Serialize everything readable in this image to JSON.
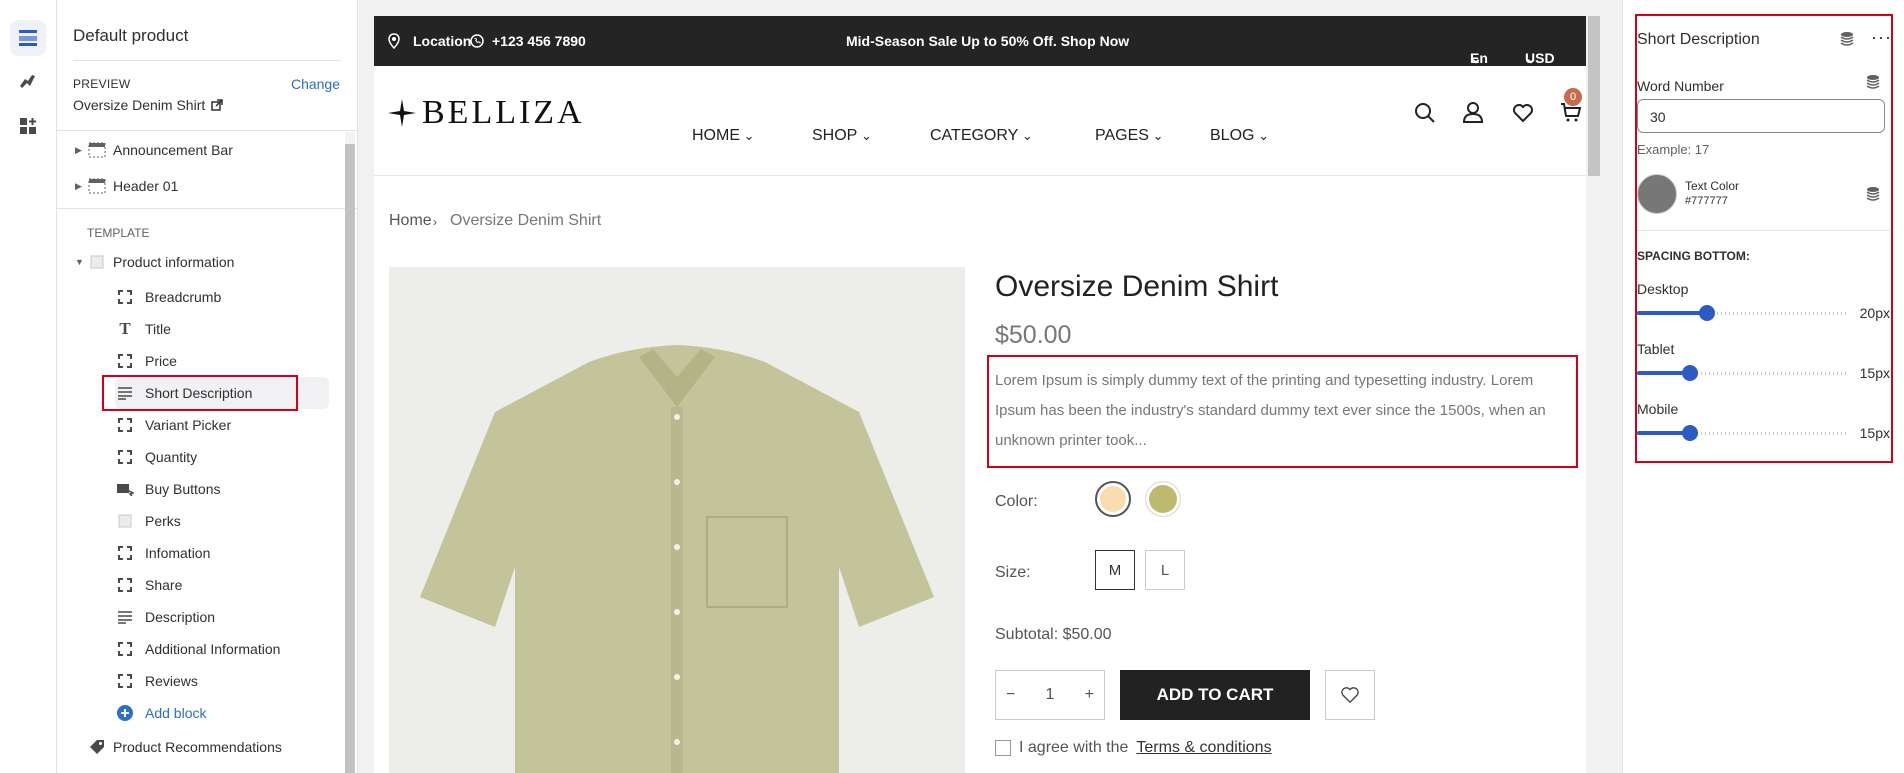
{
  "sidebar": {
    "title": "Default product",
    "preview_label": "PREVIEW",
    "change_label": "Change",
    "preview_value": "Oversize Denim Shirt",
    "sections": [
      {
        "label": "Announcement Bar"
      },
      {
        "label": "Header 01"
      }
    ],
    "template_label": "TEMPLATE",
    "product_info_label": "Product information",
    "blocks": [
      {
        "label": "Breadcrumb",
        "icon": "bracket-icon"
      },
      {
        "label": "Title",
        "icon": "text-icon"
      },
      {
        "label": "Price",
        "icon": "bracket-icon"
      },
      {
        "label": "Short Description",
        "icon": "paragraph-icon"
      },
      {
        "label": "Variant Picker",
        "icon": "bracket-icon"
      },
      {
        "label": "Quantity",
        "icon": "bracket-icon"
      },
      {
        "label": "Buy Buttons",
        "icon": "buy-icon"
      },
      {
        "label": "Perks",
        "icon": "image-icon"
      },
      {
        "label": "Infomation",
        "icon": "bracket-icon"
      },
      {
        "label": "Share",
        "icon": "bracket-icon"
      },
      {
        "label": "Description",
        "icon": "paragraph-icon"
      },
      {
        "label": "Additional Information",
        "icon": "bracket-icon"
      },
      {
        "label": "Reviews",
        "icon": "bracket-icon"
      }
    ],
    "add_block_label": "Add block",
    "recommendations_label": "Product Recommendations"
  },
  "store": {
    "topbar": {
      "location": "Location",
      "phone": "+123 456 7890",
      "promo": "Mid-Season Sale Up to 50% Off. Shop Now",
      "language": "En",
      "currency": "USD"
    },
    "logo": "BELLIZA",
    "nav": [
      "HOME",
      "SHOP",
      "CATEGORY",
      "PAGES",
      "BLOG"
    ],
    "cart_count": "0",
    "breadcrumb": {
      "home": "Home",
      "current": "Oversize Denim Shirt"
    },
    "product": {
      "title": "Oversize Denim Shirt",
      "price": "$50.00",
      "description": "Lorem Ipsum is simply dummy text of the printing and typesetting industry. Lorem Ipsum has been the industry's standard dummy text ever since the 1500s, when an unknown printer took...",
      "color_label": "Color:",
      "color_swatches": [
        "#f7ddb0",
        "#bdb96f"
      ],
      "size_label": "Size:",
      "sizes": [
        "M",
        "L"
      ],
      "subtotal": "Subtotal: $50.00",
      "quantity": "1",
      "add_to_cart": "ADD TO CART",
      "agree_prefix": "I agree with the",
      "agree_link": "Terms & conditions"
    }
  },
  "settings": {
    "title": "Short Description",
    "word_number_label": "Word Number",
    "word_number_value": "30",
    "example": "Example: 17",
    "text_color_label": "Text Color",
    "text_color_value": "#777777",
    "spacing_label": "SPACING BOTTOM:",
    "sliders": [
      {
        "label": "Desktop",
        "value": "20px",
        "fraction": 0.33
      },
      {
        "label": "Tablet",
        "value": "15px",
        "fraction": 0.25
      },
      {
        "label": "Mobile",
        "value": "15px",
        "fraction": 0.25
      }
    ]
  }
}
